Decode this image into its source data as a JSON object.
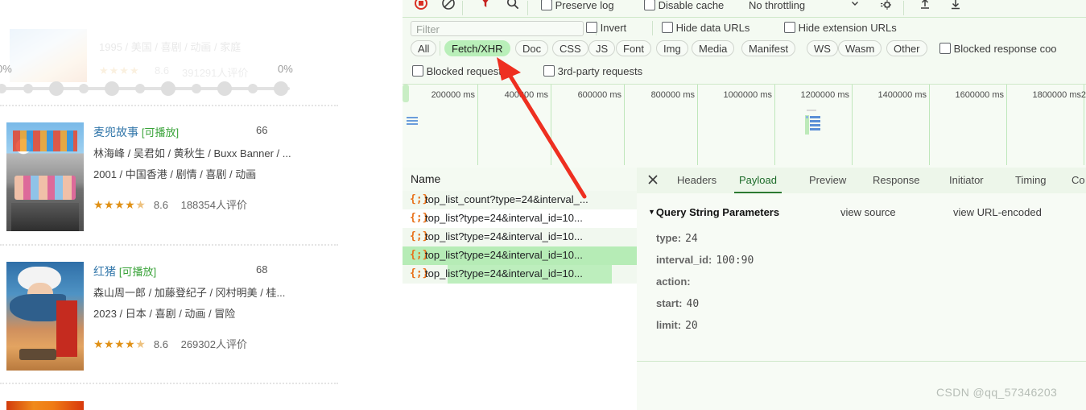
{
  "page": {
    "faded_movie": {
      "meta": "1995 / 美国 / 喜剧 / 动画 / 家庭",
      "stars": "★★★★",
      "score": "8.6",
      "votes": "391291人评价"
    },
    "slider": {
      "left_pct": "0%",
      "right_pct": "0%"
    },
    "movies": [
      {
        "title": "麦兜故事",
        "playable": "[可播放]",
        "rank": "66",
        "cast": "林海峰 / 吴君如 / 黄秋生 / Buxx Banner / ...",
        "meta": "2001 / 中国香港 / 剧情 / 喜剧 / 动画",
        "stars": "★★★★",
        "half": "★",
        "score": "8.6",
        "votes": "188354人评价"
      },
      {
        "title": "红猪",
        "playable": "[可播放]",
        "rank": "68",
        "cast": "森山周一郎 / 加藤登纪子 / 冈村明美 / 桂...",
        "meta": "2023 / 日本 / 喜剧 / 动画 / 冒险",
        "stars": "★★★★",
        "half": "★",
        "score": "8.6",
        "votes": "269302人评价"
      }
    ]
  },
  "devtools": {
    "toolbar": {
      "preserve_log": "Preserve log",
      "disable_cache": "Disable cache",
      "throttling": "No throttling"
    },
    "filterbar": {
      "filter_placeholder": "Filter",
      "invert": "Invert",
      "hide_data_urls": "Hide data URLs",
      "hide_extension_urls": "Hide extension URLs"
    },
    "type_filters": [
      {
        "label": "All",
        "active": false
      },
      {
        "label": "Fetch/XHR",
        "active": true
      },
      {
        "label": "Doc",
        "active": false
      },
      {
        "label": "CSS",
        "active": false
      },
      {
        "label": "JS",
        "active": false
      },
      {
        "label": "Font",
        "active": false
      },
      {
        "label": "Img",
        "active": false
      },
      {
        "label": "Media",
        "active": false
      },
      {
        "label": "Manifest",
        "active": false
      },
      {
        "label": "WS",
        "active": false
      },
      {
        "label": "Wasm",
        "active": false
      },
      {
        "label": "Other",
        "active": false
      }
    ],
    "blocked_response_cookies": "Blocked response coo",
    "options": {
      "blocked_requests": "Blocked requests",
      "third_party_requests": "3rd-party requests"
    },
    "overview_ticks": [
      "200000 ms",
      "400000 ms",
      "600000 ms",
      "800000 ms",
      "1000000 ms",
      "1200000 ms",
      "1400000 ms",
      "1600000 ms",
      "1800000 ms",
      "2"
    ],
    "requests": {
      "column_header": "Name",
      "rows": [
        {
          "name": "top_list_count?type=24&interval_...",
          "selected": false,
          "striped": true,
          "text_selected": false
        },
        {
          "name": "top_list?type=24&interval_id=10...",
          "selected": false,
          "striped": false,
          "text_selected": false
        },
        {
          "name": "top_list?type=24&interval_id=10...",
          "selected": false,
          "striped": true,
          "text_selected": false
        },
        {
          "name": "top_list?type=24&interval_id=10...",
          "selected": true,
          "striped": false,
          "text_selected": false
        },
        {
          "name": "top_list?type=24&interval_id=10...",
          "selected": false,
          "striped": true,
          "text_selected": true
        }
      ]
    },
    "detail": {
      "tabs": [
        {
          "label": "Headers",
          "active": false
        },
        {
          "label": "Payload",
          "active": true
        },
        {
          "label": "Preview",
          "active": false
        },
        {
          "label": "Response",
          "active": false
        },
        {
          "label": "Initiator",
          "active": false
        },
        {
          "label": "Timing",
          "active": false
        },
        {
          "label": "Co",
          "active": false
        }
      ],
      "section_title": "Query String Parameters",
      "view_source": "view source",
      "view_url_encoded": "view URL-encoded",
      "params": [
        {
          "key": "type:",
          "value": "24"
        },
        {
          "key": "interval_id:",
          "value": "100:90"
        },
        {
          "key": "action:",
          "value": ""
        },
        {
          "key": "start:",
          "value": "40"
        },
        {
          "key": "limit:",
          "value": "20"
        }
      ]
    }
  },
  "watermark": "CSDN @qq_57346203",
  "colors": {
    "accent_green": "#b9efb9",
    "panel_bg": "#f4faf2",
    "arrow_red": "#ee2f20",
    "link_blue": "#3377aa",
    "star_orange": "#e09015"
  }
}
